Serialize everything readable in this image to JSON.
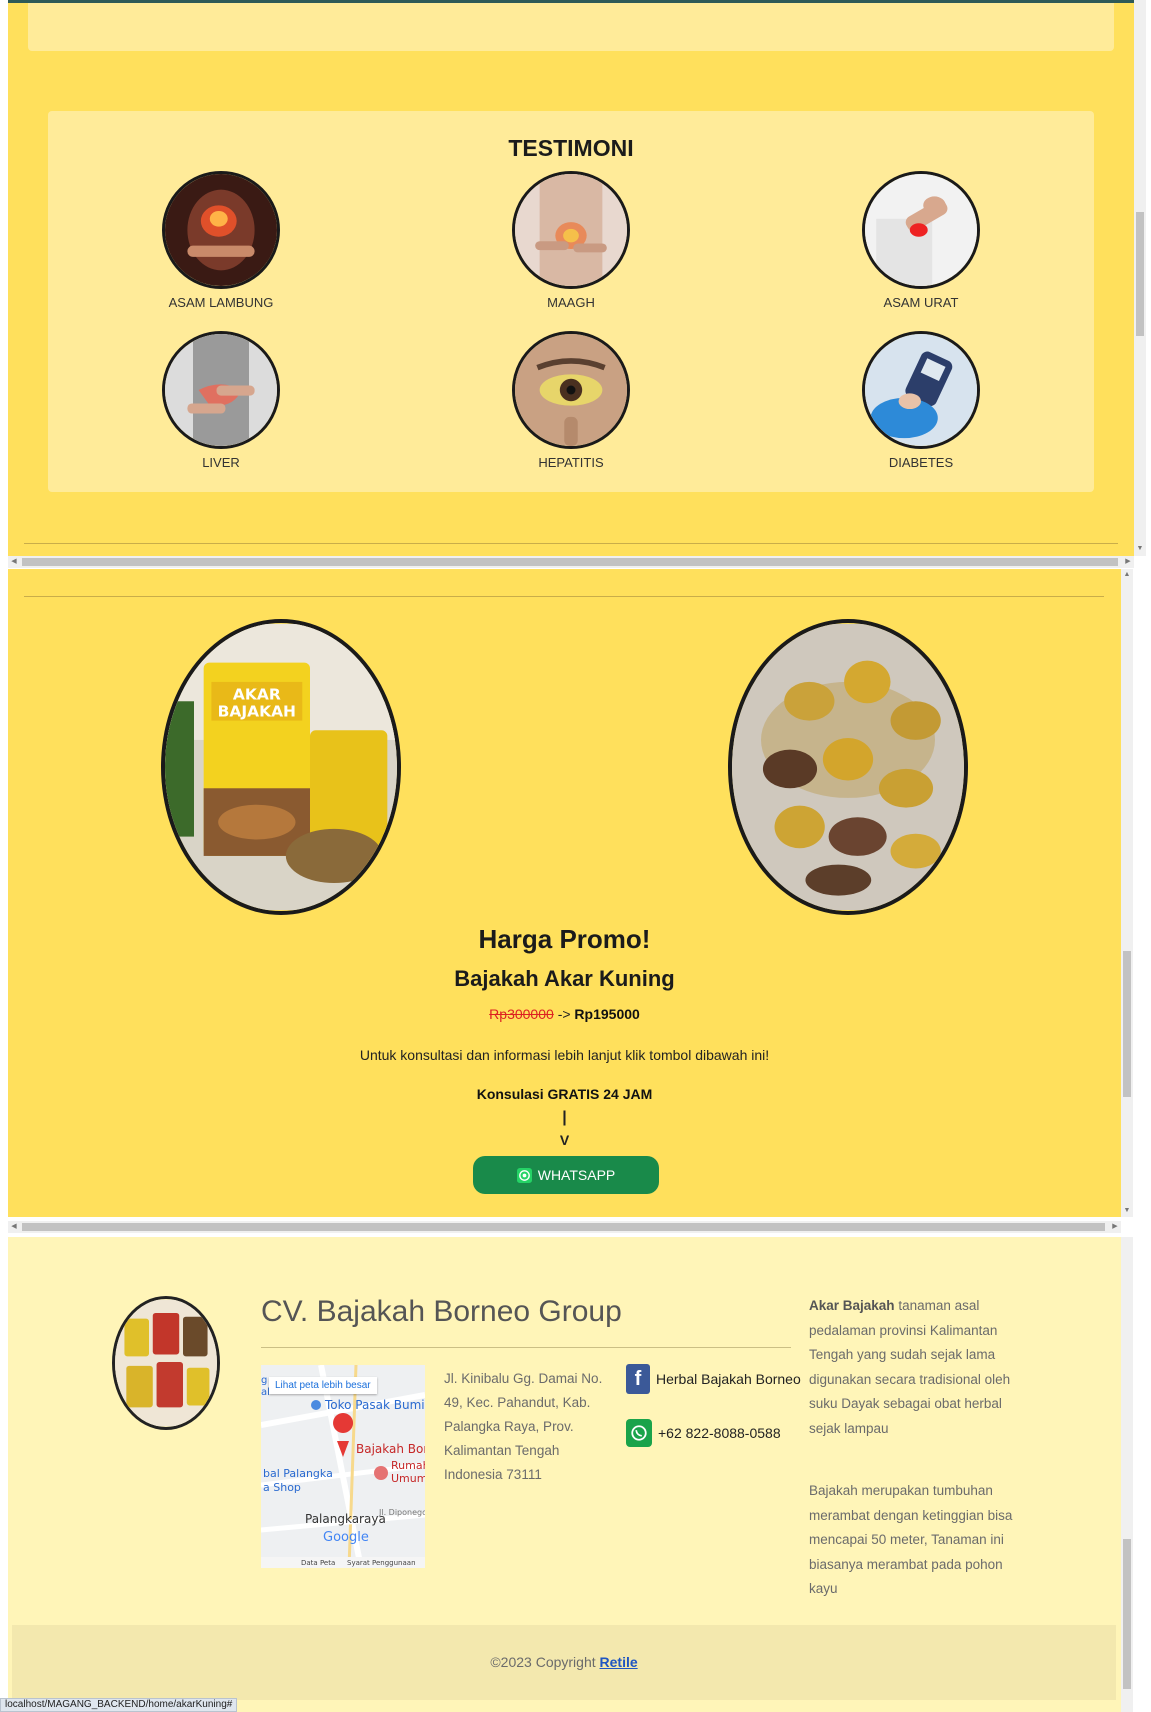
{
  "testimoni": {
    "title": "TESTIMONI",
    "items": [
      {
        "label": "ASAM LAMBUNG",
        "icon": "stomach-acid-photo"
      },
      {
        "label": "MAAGH",
        "icon": "gastric-photo"
      },
      {
        "label": "ASAM URAT",
        "icon": "gout-wrist-photo"
      },
      {
        "label": "LIVER",
        "icon": "liver-photo"
      },
      {
        "label": "HEPATITIS",
        "icon": "jaundice-eye-photo"
      },
      {
        "label": "DIABETES",
        "icon": "glucose-meter-photo"
      }
    ]
  },
  "promo": {
    "title": "Harga Promo!",
    "product": "Bajakah Akar Kuning",
    "old_price": "Rp300000",
    "arrow": "->",
    "new_price": "Rp195000",
    "info": "Untuk konsultasi dan informasi lebih lanjut klik tombol dibawah ini!",
    "konsultasi": "Konsulasi GRATIS 24 JAM",
    "pipe": "|",
    "v": "V",
    "whatsapp_label": "WHATSAPP",
    "package_text_1": "AKAR",
    "package_text_2": "BAJAKAH"
  },
  "footer": {
    "company": "CV. Bajakah Borneo Group",
    "map": {
      "link": "Lihat peta lebih besar",
      "place_1": "Toko Pasak Bumi",
      "place_2": "Bajakah Borne",
      "place_3": "Rumah",
      "place_4": "Umum",
      "place_5": "bal Palangka",
      "place_6": "a Shop",
      "place_7": "Palangkaraya",
      "place_8": "Jl. Diponego",
      "brand": "Google",
      "data": "Data Peta",
      "terms": "Syarat Penggunaan",
      "edge": "g",
      "edge2": "al"
    },
    "address": "Jl. Kinibalu Gg. Damai No. 49, Kec. Pahandut, Kab. Palangka Raya, Prov. Kalimantan Tengah Indonesia 73111",
    "facebook": "Herbal Bajakah Borneo",
    "phone": "+62 822-8088-0588",
    "about_bold": "Akar Bajakah",
    "about_rest": " tanaman asal pedalaman provinsi Kalimantan Tengah yang sudah sejak lama digunakan secara tradisional oleh suku Dayak sebagai obat herbal sejak lampau",
    "about_2": "Bajakah merupakan tumbuhan merambat dengan ketinggian bisa mencapai 50 meter, Tanaman ini biasanya merambat pada pohon kayu",
    "copyright": "©2023 Copyright ",
    "copyright_link": "Retile"
  },
  "status_url": "localhost/MAGANG_BACKEND/home/akarKuning#"
}
